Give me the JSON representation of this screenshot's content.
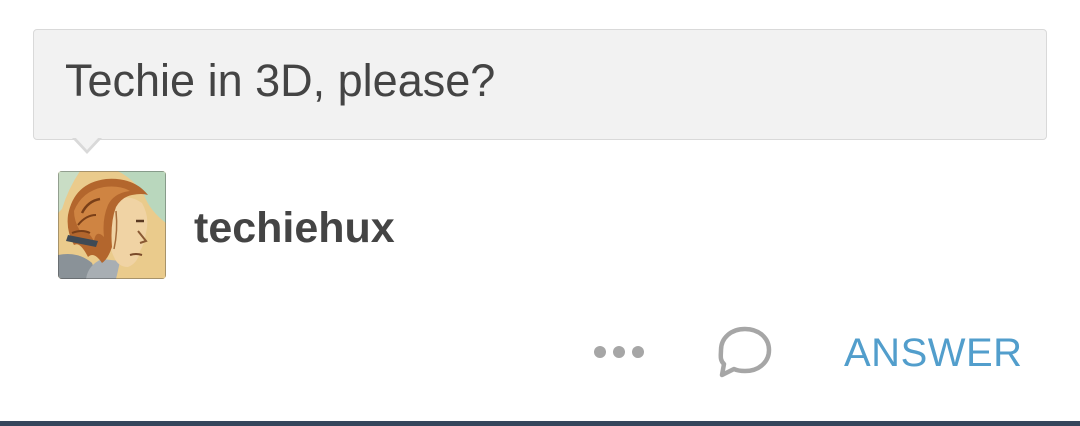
{
  "question": {
    "text": "Techie in 3D, please?"
  },
  "asker": {
    "username": "techiehux",
    "avatar_icon": "illustrated-portrait-avatar"
  },
  "actions": {
    "more_icon": "ellipsis-icon",
    "reply_icon": "speech-bubble-icon",
    "answer_label": "ANSWER"
  },
  "colors": {
    "accent": "#529ecc",
    "text": "#444444",
    "bubble_background": "#f2f2f2",
    "dashboard_bar": "#35465c"
  }
}
